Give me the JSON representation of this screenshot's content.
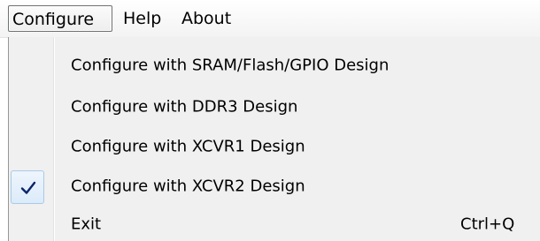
{
  "menubar": {
    "items": [
      {
        "label": "Configure"
      },
      {
        "label": "Help"
      },
      {
        "label": "About"
      }
    ]
  },
  "dropdown": {
    "items": [
      {
        "label": "Configure with SRAM/Flash/GPIO Design",
        "checked": false,
        "shortcut": ""
      },
      {
        "label": "Configure with DDR3 Design",
        "checked": false,
        "shortcut": ""
      },
      {
        "label": "Configure with XCVR1 Design",
        "checked": false,
        "shortcut": ""
      },
      {
        "label": "Configure with XCVR2 Design",
        "checked": true,
        "shortcut": ""
      },
      {
        "label": "Exit",
        "checked": false,
        "shortcut": "Ctrl+Q"
      }
    ]
  },
  "colors": {
    "menu_background": "#f0f0f0",
    "checkmark": "#0a246a",
    "check_highlight_border": "#a8cae8"
  },
  "icons": {
    "checked_item": "checkmark-icon"
  }
}
